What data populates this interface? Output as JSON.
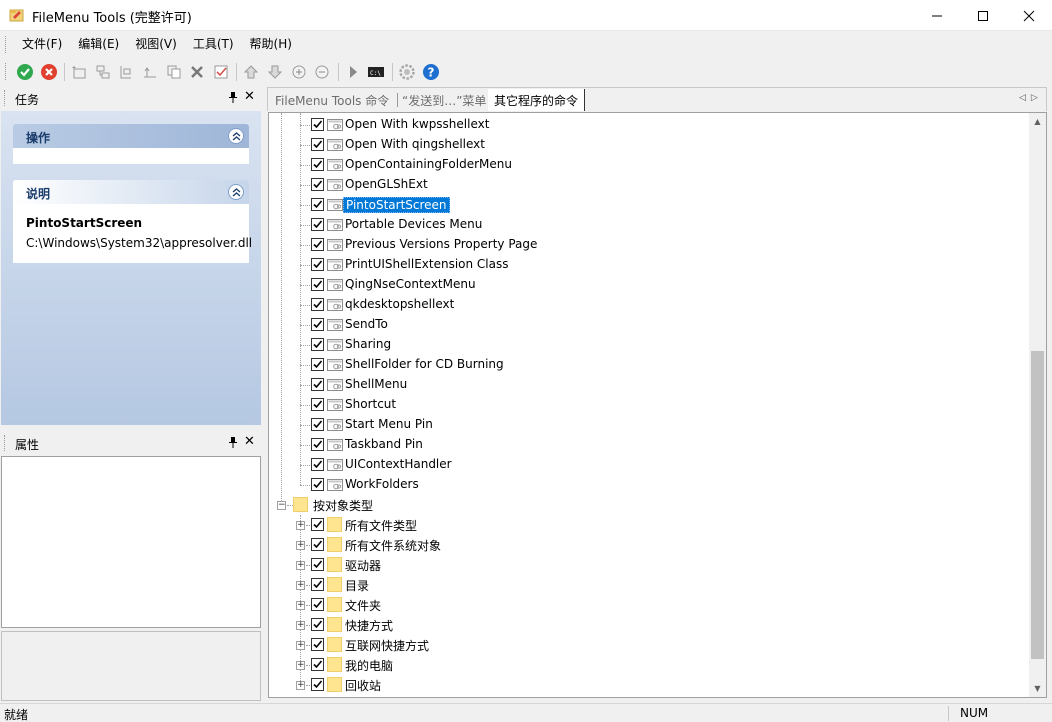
{
  "window": {
    "title": "FileMenu Tools (完整许可)"
  },
  "menu": [
    "文件(F)",
    "编辑(E)",
    "视图(V)",
    "工具(T)",
    "帮助(H)"
  ],
  "toolbar": {
    "icons": [
      "apply-icon",
      "cancel-icon",
      "new-item-icon",
      "new-submenu-icon",
      "new-separator-icon",
      "move-out-icon",
      "copy-icon",
      "delete-icon",
      "check-icon",
      "move-up-icon",
      "move-down-icon",
      "expand-icon",
      "collapse-icon",
      "run-icon",
      "console-icon",
      "settings-icon",
      "help-icon"
    ]
  },
  "left": {
    "tasks_title": "任务",
    "group_actions": "操作",
    "group_description": "说明",
    "desc_name": "PintoStartScreen",
    "desc_path": "C:\\Windows\\System32\\appresolver.dll",
    "props_title": "属性"
  },
  "tabs": [
    {
      "label": "FileMenu Tools 命令",
      "active": false
    },
    {
      "label": "“发送到…”菜单",
      "active": false
    },
    {
      "label": "其它程序的命令",
      "active": true
    }
  ],
  "tree": {
    "extensions": [
      "Open With kwpsshellext",
      "Open With qingshellext",
      "OpenContainingFolderMenu",
      "OpenGLShExt",
      "PintoStartScreen",
      "Portable Devices Menu",
      "Previous Versions Property Page",
      "PrintUIShellExtension Class",
      "QingNseContextMenu",
      "qkdesktopshellext",
      "SendTo",
      "Sharing",
      "ShellFolder for CD Burning",
      "ShellMenu",
      "Shortcut",
      "Start Menu Pin",
      "Taskband Pin",
      "UIContextHandler",
      "WorkFolders"
    ],
    "selected": "PintoStartScreen",
    "group_label": "按对象类型",
    "object_types": [
      "所有文件类型",
      "所有文件系统对象",
      "驱动器",
      "目录",
      "文件夹",
      "快捷方式",
      "互联网快捷方式",
      "我的电脑",
      "回收站"
    ]
  },
  "status": {
    "text": "就绪",
    "num": "NUM"
  }
}
